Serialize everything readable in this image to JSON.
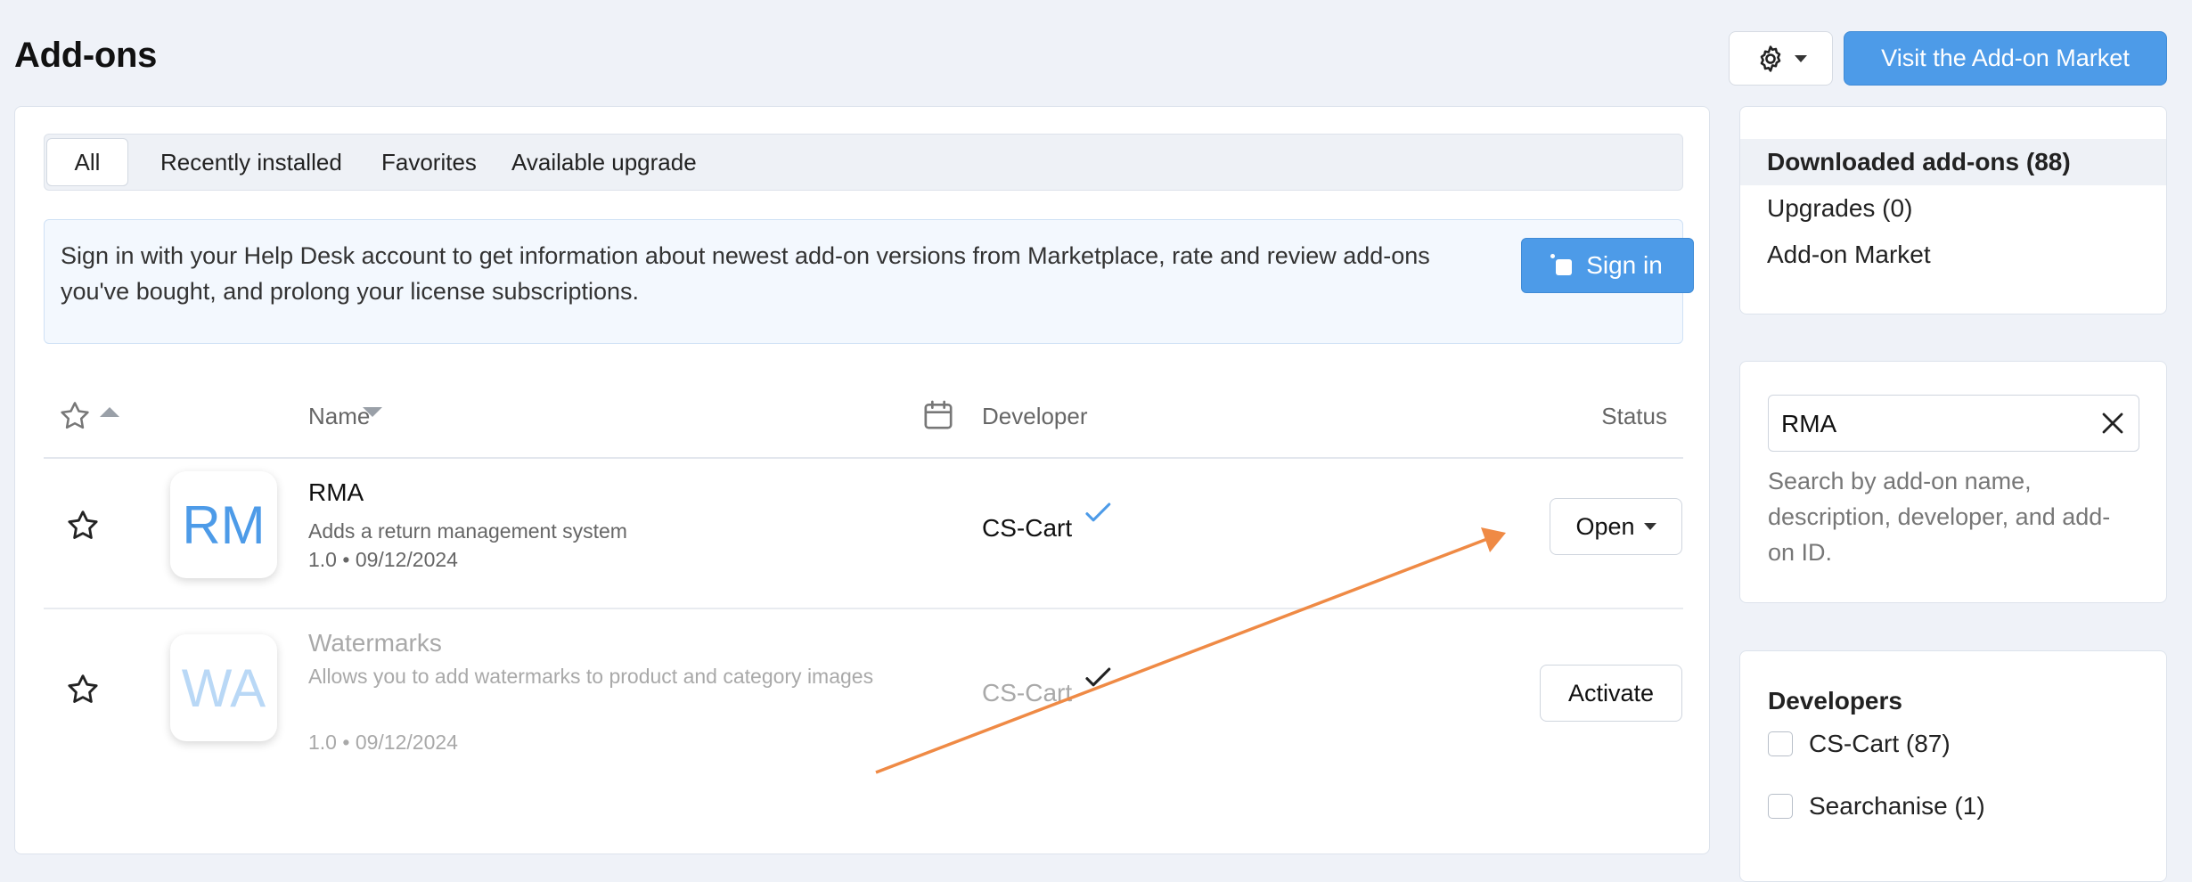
{
  "page": {
    "title": "Add-ons"
  },
  "header": {
    "settings_icon": "gear-icon",
    "market_button": "Visit the Add-on Market"
  },
  "tabs": [
    {
      "label": "All",
      "active": true
    },
    {
      "label": "Recently installed"
    },
    {
      "label": "Favorites"
    },
    {
      "label": "Available upgrade"
    }
  ],
  "notice": {
    "text": "Sign in with your Help Desk account to get information about newest add-on versions from Marketplace, rate and review add-ons you've bought, and prolong your license subscriptions.",
    "button": "Sign in"
  },
  "table": {
    "columns": {
      "name": "Name",
      "developer": "Developer",
      "status": "Status"
    },
    "rows": [
      {
        "logo": "RM",
        "name": "RMA",
        "description": "Adds a return management system",
        "version": "1.0",
        "date": "09/12/2024",
        "developer": "CS-Cart",
        "check_color": "#4d9be8",
        "action": "Open",
        "active": true
      },
      {
        "logo": "WA",
        "name": "Watermarks",
        "description": "Allows you to add watermarks to product and category images",
        "version": "1.0",
        "date": "09/12/2024",
        "developer": "CS-Cart",
        "check_color": "#222222",
        "action": "Activate",
        "active": false
      }
    ]
  },
  "sidebar": {
    "nav": [
      {
        "label": "Downloaded add-ons (88)",
        "active": true
      },
      {
        "label": "Upgrades (0)"
      },
      {
        "label": "Add-on Market"
      }
    ],
    "search": {
      "value": "RMA",
      "hint": "Search by add-on name, description, developer, and add-on ID."
    },
    "developers": {
      "title": "Developers",
      "items": [
        {
          "label": "CS-Cart (87)",
          "checked": false
        },
        {
          "label": "Searchanise (1)",
          "checked": false
        }
      ]
    }
  },
  "colors": {
    "accent": "#4d9be8",
    "annotation_arrow": "#ef8a45"
  }
}
